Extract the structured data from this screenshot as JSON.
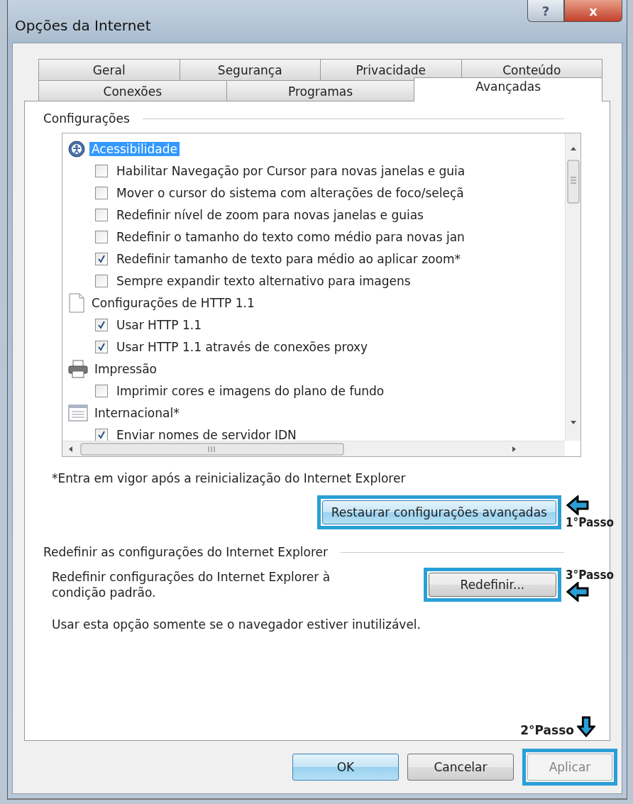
{
  "window": {
    "title": "Opções da Internet",
    "help_button": "?",
    "close_button": "x"
  },
  "tabs": [
    [
      {
        "label": "Geral",
        "selected": false
      },
      {
        "label": "Segurança",
        "selected": false
      },
      {
        "label": "Privacidade",
        "selected": false
      },
      {
        "label": "Conteúdo",
        "selected": false
      }
    ],
    [
      {
        "label": "Conexões",
        "selected": false
      },
      {
        "label": "Programas",
        "selected": false
      },
      {
        "label": "Avançadas",
        "selected": true
      }
    ]
  ],
  "settings": {
    "group_title": "Configurações",
    "tree": [
      {
        "kind": "accessibility",
        "label": "Acessibilidade",
        "selected": true,
        "children": [
          {
            "label": "Habilitar Navegação por Cursor para novas janelas e guia",
            "checked": false
          },
          {
            "label": "Mover o cursor do sistema com alterações de foco/seleçã",
            "checked": false
          },
          {
            "label": "Redefinir nível de zoom para novas janelas e guias",
            "checked": false
          },
          {
            "label": "Redefinir o tamanho do texto como médio para novas jan",
            "checked": false
          },
          {
            "label": "Redefinir tamanho de texto para médio ao aplicar zoom*",
            "checked": true
          },
          {
            "label": "Sempre expandir texto alternativo para imagens",
            "checked": false
          }
        ]
      },
      {
        "kind": "document",
        "label": "Configurações de HTTP 1.1",
        "selected": false,
        "children": [
          {
            "label": "Usar HTTP 1.1",
            "checked": true
          },
          {
            "label": "Usar HTTP 1.1 através de conexões proxy",
            "checked": true
          }
        ]
      },
      {
        "kind": "printer",
        "label": "Impressão",
        "selected": false,
        "children": [
          {
            "label": "Imprimir cores e imagens do plano de fundo",
            "checked": false
          }
        ]
      },
      {
        "kind": "list",
        "label": "Internacional*",
        "selected": false,
        "children": [
          {
            "label": "Enviar nomes de servidor IDN",
            "checked": true
          }
        ]
      }
    ],
    "note": "*Entra em vigor após a reinicialização do Internet Explorer",
    "restore_button": {
      "label": "Restaurar configurações avançadas",
      "highlighted": true,
      "step": {
        "label": "1°Passo",
        "kind": "above"
      }
    }
  },
  "reset_group": {
    "title": "Redefinir as configurações do Internet Explorer",
    "description": "Redefinir configurações do Internet Explorer à condição padrão.",
    "button": {
      "label": "Redefinir...",
      "highlighted": true,
      "step": {
        "label": "3°Passo",
        "kind": "below"
      }
    },
    "hint": "Usar esta opção somente se o navegador estiver inutilizável."
  },
  "footer": {
    "step": {
      "label": "2°Passo",
      "kind": "after"
    },
    "buttons": [
      {
        "label": "OK",
        "default": true,
        "disabled": false,
        "highlighted": false
      },
      {
        "label": "Cancelar",
        "default": false,
        "disabled": false,
        "highlighted": false
      },
      {
        "label": "Aplicar",
        "default": false,
        "disabled": true,
        "highlighted": true
      }
    ]
  }
}
